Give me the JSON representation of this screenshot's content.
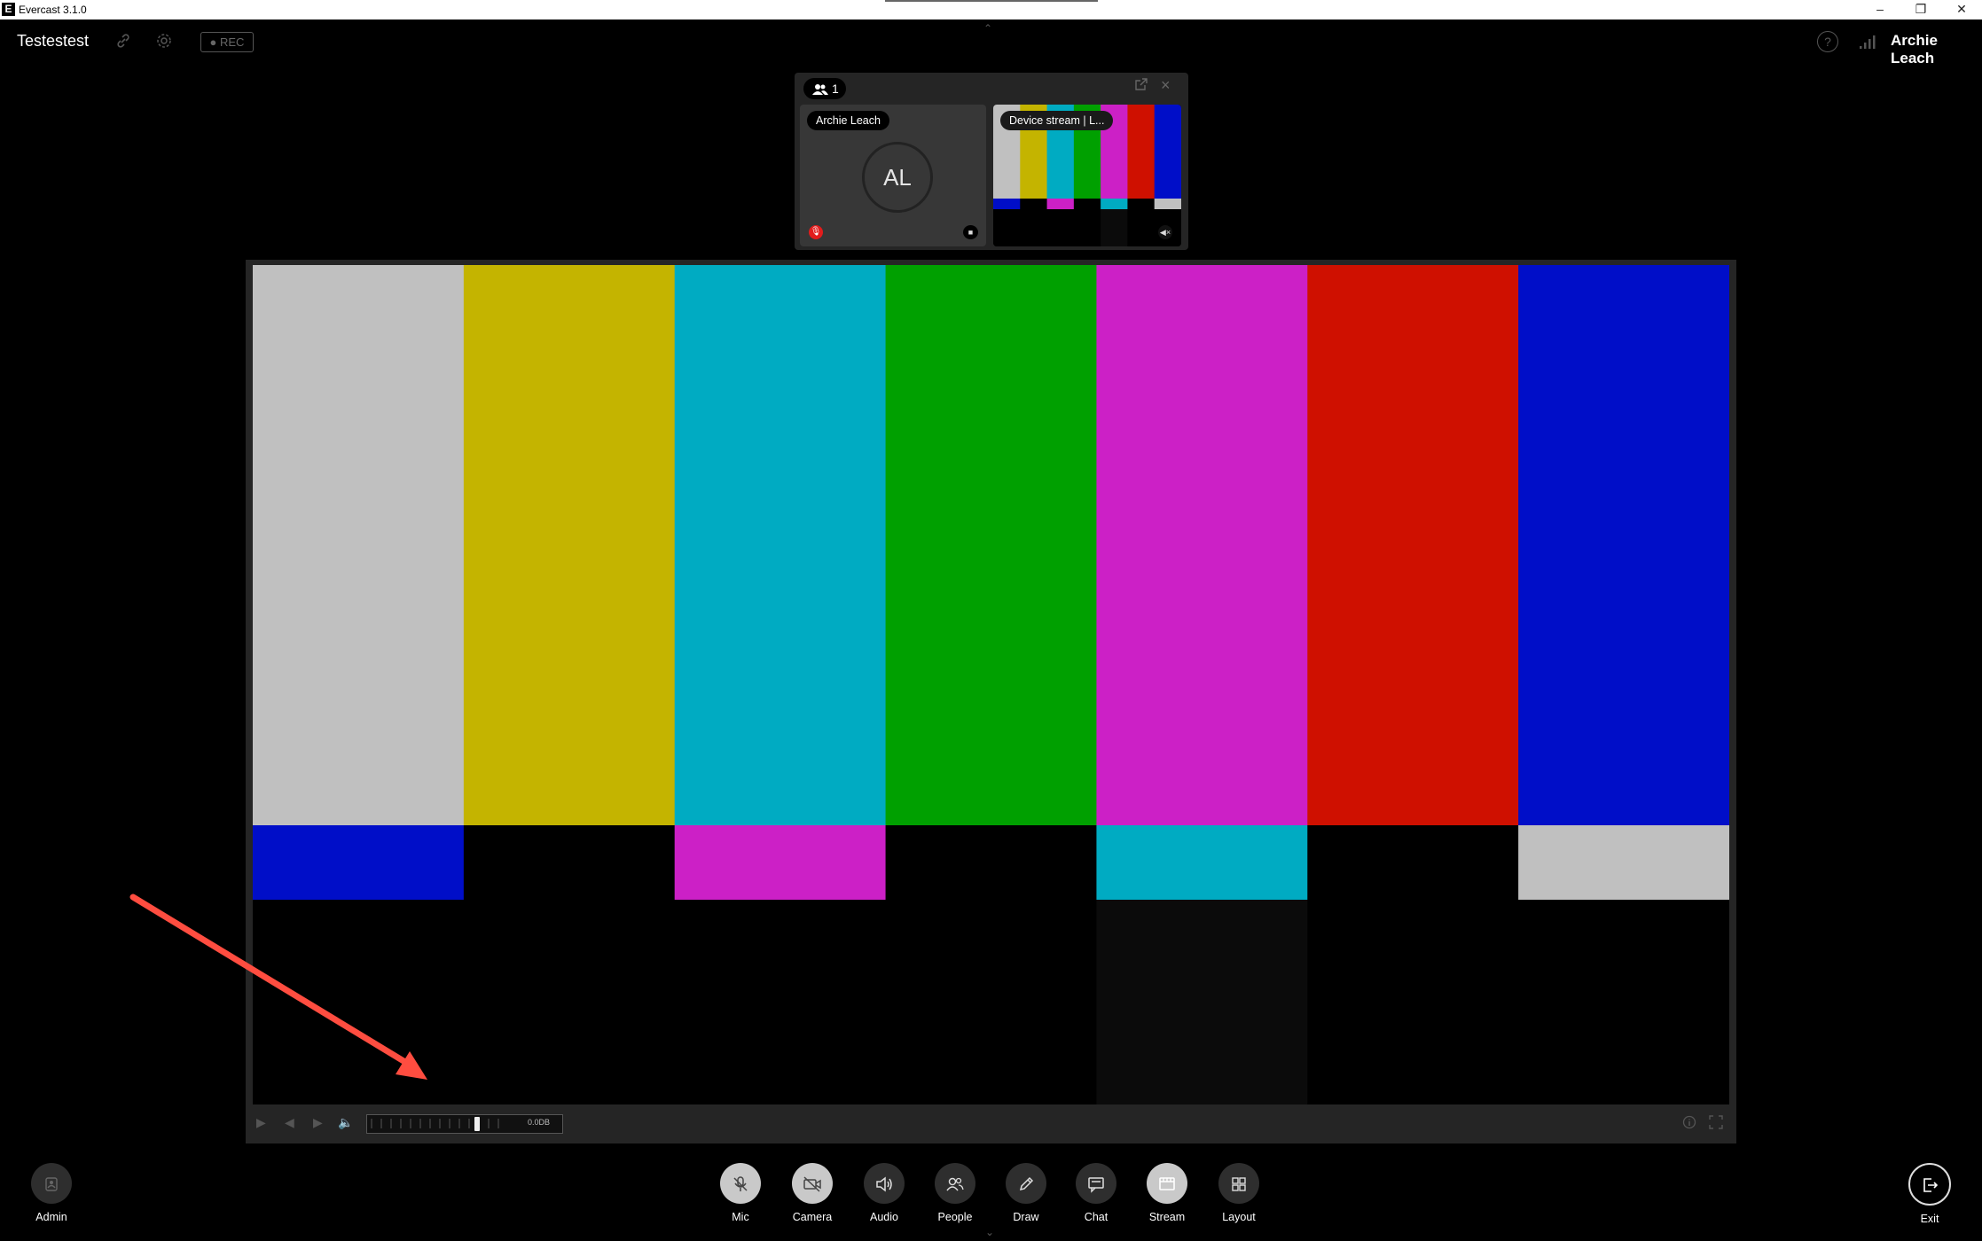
{
  "os": {
    "title": "Evercast 3.1.0",
    "logo": "E",
    "minimize": "–",
    "maximize": "❐",
    "close": "✕"
  },
  "header": {
    "room_name": "Testestest",
    "rec_label": "● REC",
    "user_name": "Archie Leach",
    "help_glyph": "?",
    "icons": [
      "link-icon",
      "gear-icon",
      "help-icon",
      "signal-icon"
    ]
  },
  "panel": {
    "participant_count": "1",
    "tiles": [
      {
        "label": "Archie Leach",
        "initials": "AL"
      },
      {
        "label": "Device stream | L..."
      }
    ]
  },
  "player": {
    "level_readout": "0.0DB"
  },
  "test_pattern": {
    "top_bars": [
      "#c0c0c0",
      "#c4b400",
      "#00abc2",
      "#00a000",
      "#cc20c6",
      "#cf1000",
      "#000ec8"
    ],
    "middle_bars": [
      "#000ec8",
      "#000000",
      "#cc20c6",
      "#000000",
      "#00abc2",
      "#000000",
      "#c0c0c0"
    ],
    "bottom_bars": [
      "#000000",
      "#000000",
      "#000000",
      "#000000",
      "#0b0b0b",
      "#000000",
      "#000000"
    ]
  },
  "annotation": {
    "arrow_color": "#ff4d40"
  },
  "toolbar": {
    "admin": "Admin",
    "mic": "Mic",
    "camera": "Camera",
    "audio": "Audio",
    "people": "People",
    "draw": "Draw",
    "chat": "Chat",
    "stream": "Stream",
    "layout": "Layout",
    "exit": "Exit"
  }
}
